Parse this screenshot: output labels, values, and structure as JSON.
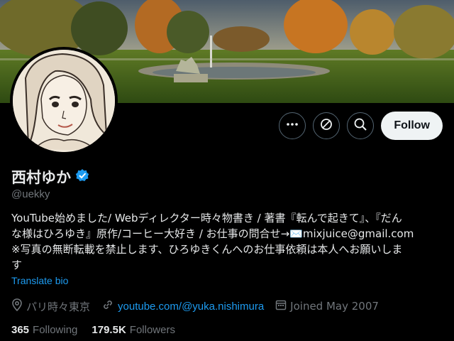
{
  "profile": {
    "display_name": "西村ゆか",
    "handle": "@uekky",
    "verified": true,
    "bio_lines": [
      "YouTube始めました/ Webディレクター時々物書き / 著書『転んで起きて』、『だん",
      "な様はひろゆき』原作/コーヒー大好き / お仕事の問合せ→✉️mixjuice@gmail.com",
      "※写真の無断転載を禁止します、ひろゆきくんへのお仕事依頼は本人へお願いしま",
      "す"
    ],
    "translate_label": "Translate bio",
    "location": "パリ時々東京",
    "website": "youtube.com/@yuka.nishimura",
    "joined": "Joined May 2007"
  },
  "stats": {
    "following_count": "365",
    "following_label": "Following",
    "followers_count": "179.5K",
    "followers_label": "Followers"
  },
  "actions": {
    "follow_label": "Follow",
    "more_icon": "more-icon",
    "subscribe_icon": "subscribe-icon",
    "search_icon": "search-icon"
  },
  "colors": {
    "accent": "#1d9bf0",
    "background": "#000000",
    "muted_text": "#71767b",
    "follow_bg": "#eff3f4"
  }
}
